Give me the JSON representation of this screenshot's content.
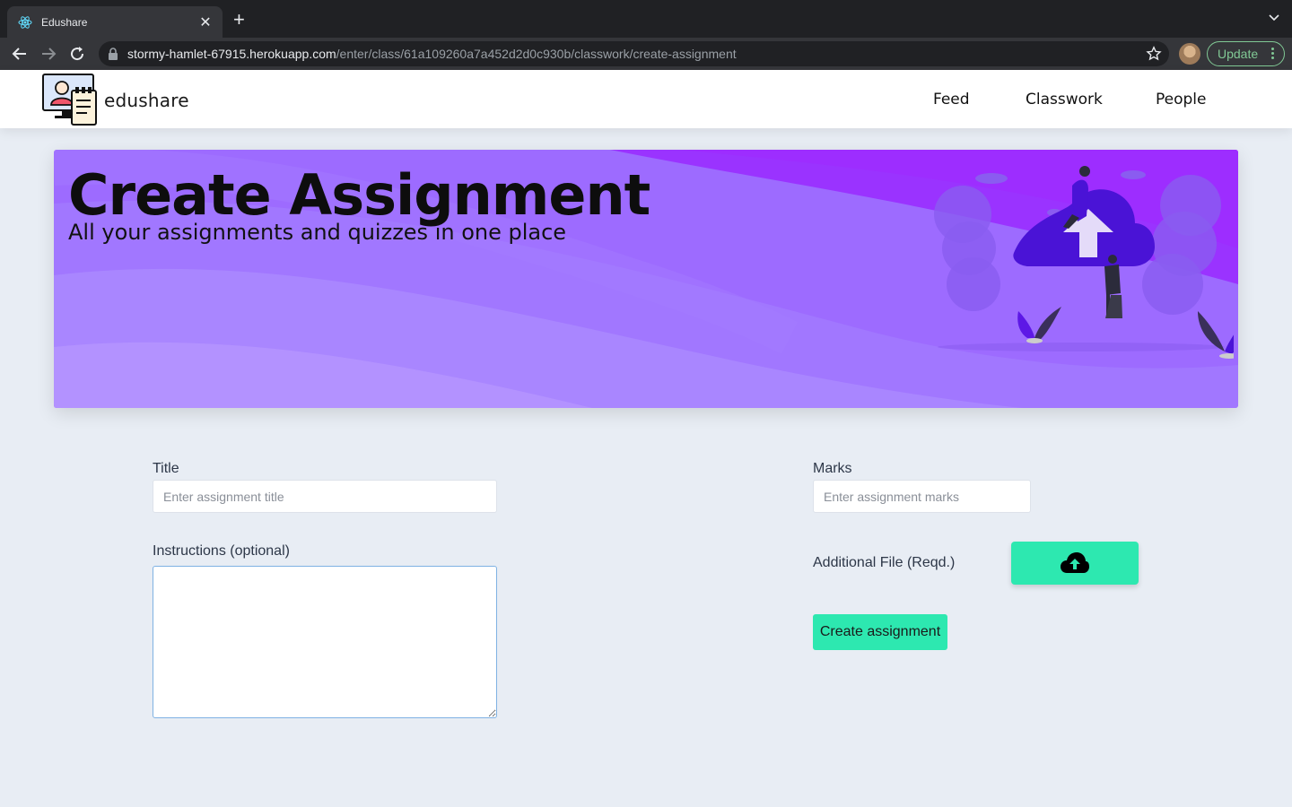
{
  "browser": {
    "tab_title": "Edushare",
    "url_host": "stormy-hamlet-67915.herokuapp.com",
    "url_path": "/enter/class/61a109260a7a452d2d0c930b/classwork/create-assignment",
    "update_label": "Update"
  },
  "app": {
    "brand": "edushare",
    "nav": [
      "Feed",
      "Classwork",
      "People"
    ]
  },
  "banner": {
    "title": "Create Assignment",
    "subtitle": "All your assignments and quizzes in one place"
  },
  "form": {
    "title_label": "Title",
    "title_placeholder": "Enter assignment title",
    "marks_label": "Marks",
    "marks_placeholder": "Enter assignment marks",
    "instructions_label": "Instructions (optional)",
    "file_label": "Additional File (Reqd.)",
    "upload_icon": "cloud-upload-icon",
    "submit_label": "Create assignment"
  },
  "colors": {
    "accent": "#2de8b0",
    "banner_purple": "#9b4dff"
  }
}
